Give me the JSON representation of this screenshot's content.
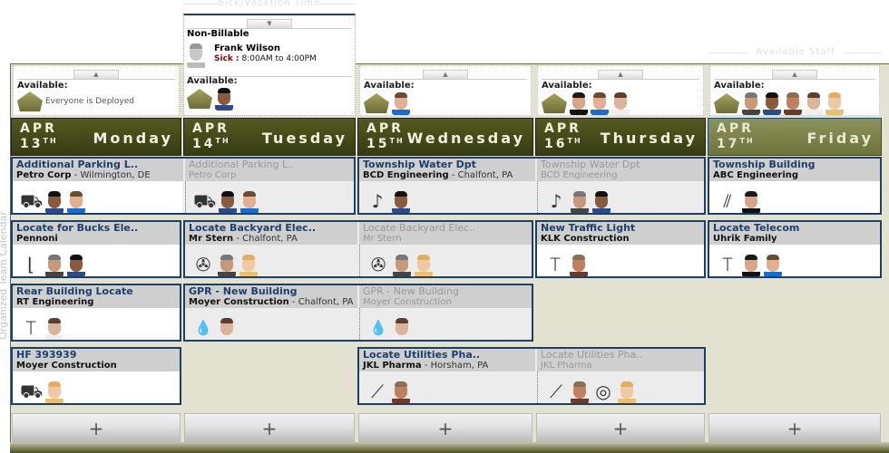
{
  "app_label": "Organized Team Calendar",
  "section_labels": {
    "sick": "Sick/Vacation Time",
    "available": "Available Staff"
  },
  "sick": {
    "heading": "Non-Billable",
    "name": "Frank Wilson",
    "type": "Sick :",
    "time": "8:00AM to 4:00PM"
  },
  "available_label": "Available:",
  "days": [
    {
      "month": "APR",
      "day": "13",
      "suffix": "TH",
      "name": "Monday",
      "available": [],
      "empty_text": "Everyone is Deployed"
    },
    {
      "month": "APR",
      "day": "14",
      "suffix": "TH",
      "name": "Tuesday",
      "available": [
        "black-hair-dark"
      ]
    },
    {
      "month": "APR",
      "day": "15",
      "suffix": "TH",
      "name": "Wednesday",
      "available": [
        "blue-shirt"
      ]
    },
    {
      "month": "APR",
      "day": "16",
      "suffix": "TH",
      "name": "Thursday",
      "available": [
        "young-dark",
        "blue-shirt",
        "goatee"
      ]
    },
    {
      "month": "APR",
      "day": "17",
      "suffix": "TH",
      "name": "Friday",
      "available": [
        "gray-hair",
        "black-hair-dark",
        "mustache",
        "goatee",
        "blonde"
      ]
    }
  ],
  "events": [
    {
      "row": 0,
      "start": 0,
      "span": 2,
      "title": "Additional Parking L..",
      "client": "Petro Corp",
      "location": "Wilmington, DE",
      "items": [
        "equipment:trailer-vacuum",
        "black-hair-dark",
        "blue-shirt"
      ]
    },
    {
      "row": 0,
      "start": 2,
      "span": 2,
      "title": "Township Water Dpt",
      "client": "BCD Engineering",
      "location": "Chalfont, PA",
      "items": [
        "equipment:pipe-locator",
        "black-hair-dark"
      ],
      "cont_items": [
        "equipment:pipe-locator",
        "gray-hair",
        "black-hair-dark"
      ]
    },
    {
      "row": 0,
      "start": 4,
      "span": 1,
      "title": "Township Building",
      "client": "ABC Engineering",
      "location": "",
      "items": [
        "equipment:probes",
        "young-dark"
      ]
    },
    {
      "row": 1,
      "start": 0,
      "span": 1,
      "title": "Locate for Bucks Ele..",
      "client": "Pennoni",
      "location": "",
      "items": [
        "equipment:gpr-cart",
        "gray-hair",
        "black-hair-dark"
      ]
    },
    {
      "row": 1,
      "start": 1,
      "span": 2,
      "title": "Locate Backyard Elec..",
      "client": "Mr Stern",
      "location": "Chalfont, PA",
      "items": [
        "equipment:camera-kit",
        "gray-hair",
        "blonde"
      ]
    },
    {
      "row": 1,
      "start": 3,
      "span": 1,
      "title": "New Traffic Light",
      "client": "KLK Construction",
      "location": "",
      "items": [
        "equipment:cable-locator",
        "mustache"
      ]
    },
    {
      "row": 1,
      "start": 4,
      "span": 1,
      "title": "Locate Telecom",
      "client": "Uhrik Family",
      "location": "",
      "items": [
        "equipment:cable-locator",
        "young-dark",
        "blue-shirt"
      ]
    },
    {
      "row": 2,
      "start": 0,
      "span": 1,
      "title": "Rear Building Locate",
      "client": "RT Engineering",
      "location": "",
      "items": [
        "equipment:cable-locator",
        "goatee"
      ]
    },
    {
      "row": 2,
      "start": 1,
      "span": 2,
      "title": "GPR - New Building",
      "client": "Moyer Construction",
      "location": "Chalfont, PA",
      "items": [
        "equipment:gas-detector",
        "goatee"
      ]
    },
    {
      "row": 3,
      "start": 0,
      "span": 1,
      "title": "HF 393939",
      "client": "Moyer Construction",
      "location": "",
      "items": [
        "equipment:trailer-vacuum",
        "blonde"
      ]
    },
    {
      "row": 3,
      "start": 2,
      "span": 2,
      "title": "Locate Utilities Pha..",
      "client": "JKL Pharma",
      "location": "Horsham, PA",
      "items": [
        "equipment:tripod",
        "mustache"
      ],
      "cont_items": [
        "equipment:tripod",
        "mustache",
        "equipment:marking-tape",
        "blonde"
      ]
    }
  ],
  "add_label": "+",
  "colors": {
    "olive": "#4a4d1c",
    "title_blue": "#1c3f6e",
    "border_blue": "#1c3f63",
    "board": "#e3e1d0"
  }
}
